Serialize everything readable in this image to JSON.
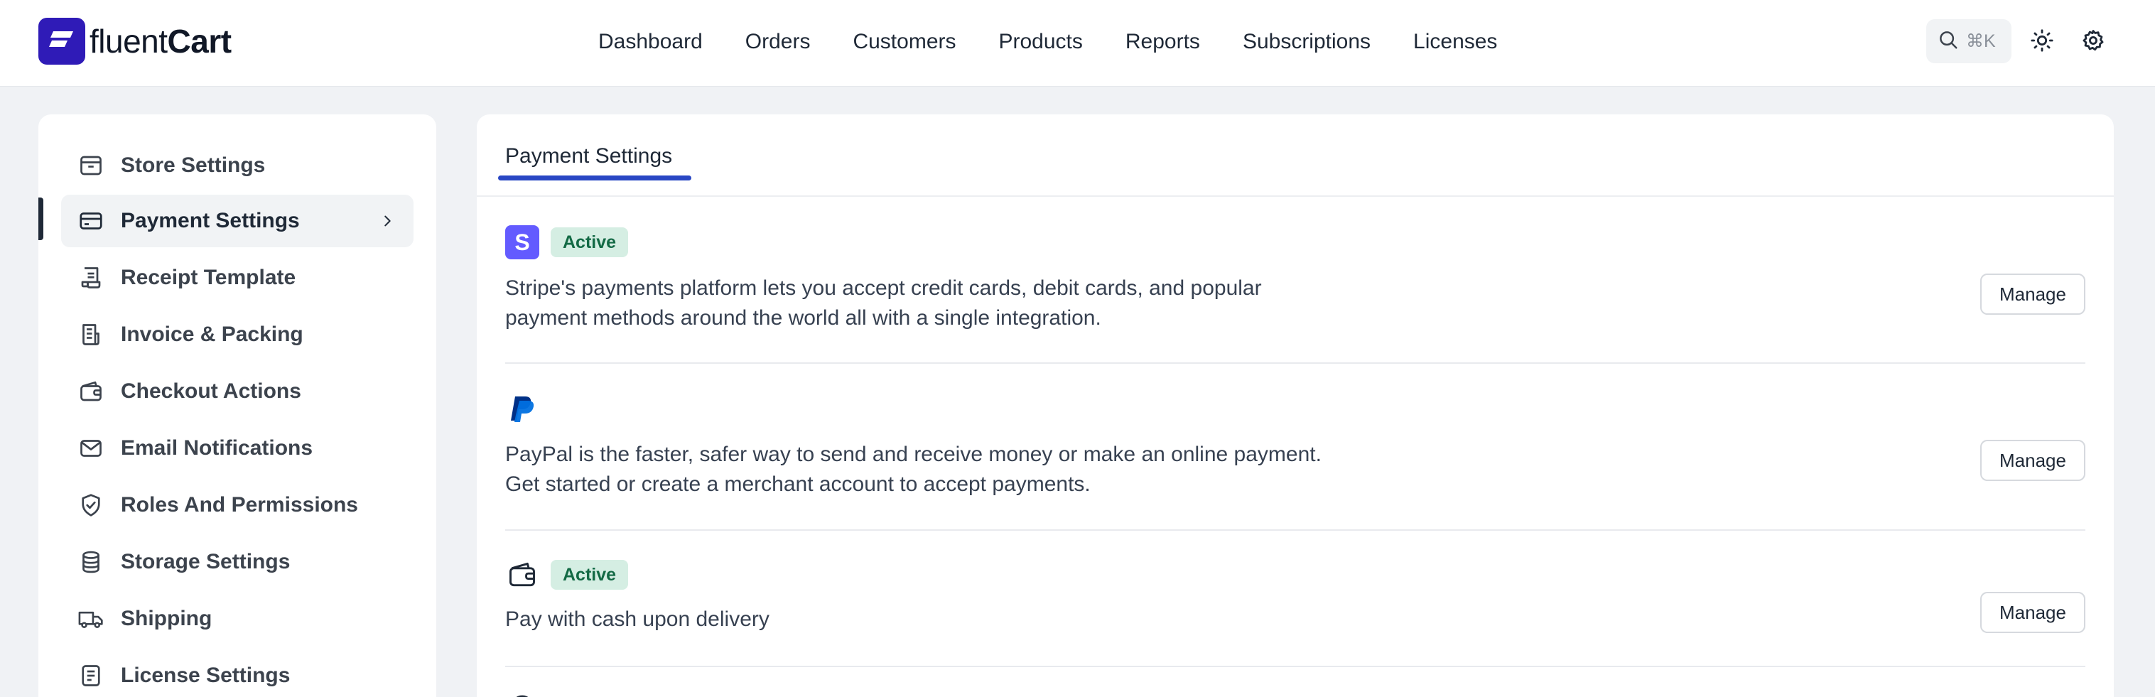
{
  "brand": {
    "name_part1": "fluent",
    "name_part2": "Cart",
    "icon": "fluentcart-logo"
  },
  "nav": [
    "Dashboard",
    "Orders",
    "Customers",
    "Products",
    "Reports",
    "Subscriptions",
    "Licenses"
  ],
  "header": {
    "search_shortcut": "⌘K",
    "icons": [
      "search-icon",
      "sun-icon",
      "gear-icon"
    ]
  },
  "sidebar": {
    "items": [
      {
        "label": "Store Settings",
        "icon": "store-icon"
      },
      {
        "label": "Payment Settings",
        "icon": "credit-card-icon",
        "active": true
      },
      {
        "label": "Receipt Template",
        "icon": "receipt-icon"
      },
      {
        "label": "Invoice & Packing",
        "icon": "invoice-icon"
      },
      {
        "label": "Checkout Actions",
        "icon": "wallet-icon"
      },
      {
        "label": "Email Notifications",
        "icon": "mail-icon"
      },
      {
        "label": "Roles And Permissions",
        "icon": "shield-check-icon"
      },
      {
        "label": "Storage Settings",
        "icon": "database-icon"
      },
      {
        "label": "Shipping",
        "icon": "truck-icon"
      },
      {
        "label": "License Settings",
        "icon": "license-icon"
      }
    ]
  },
  "main": {
    "tab": "Payment Settings",
    "gateways": [
      {
        "logo": "stripe-logo",
        "status": "Active",
        "description_line1": "Stripe's payments platform lets you accept credit cards, debit cards, and popular",
        "description_line2": "payment methods around the world all with a single integration.",
        "button": "Manage"
      },
      {
        "logo": "paypal-logo",
        "status": "",
        "description_line1": "PayPal is the faster, safer way to send and receive money or make an online payment.",
        "description_line2": "Get started or create a merchant account to accept payments.",
        "button": "Manage"
      },
      {
        "logo": "wallet-icon",
        "status": "Active",
        "description_line1": "Pay with cash upon delivery",
        "button": "Manage"
      }
    ]
  },
  "colors": {
    "brand": "#2f1bb7",
    "tab_underline": "#2947c4",
    "badge_bg": "#d5eee3",
    "badge_text": "#136a45",
    "stripe": "#635bff",
    "page_bg": "#f0f2f5"
  }
}
